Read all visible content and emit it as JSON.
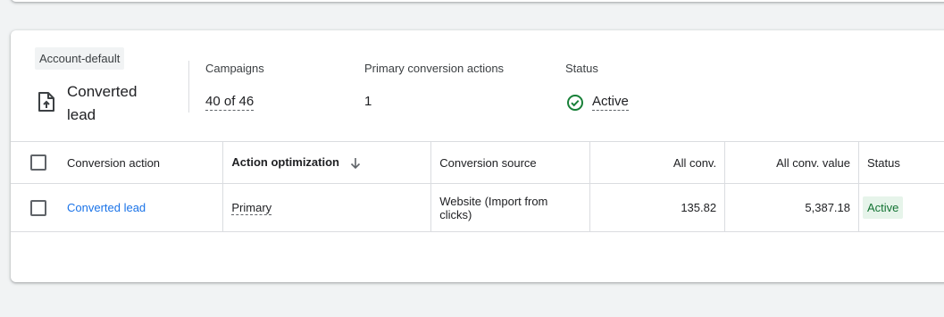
{
  "summary": {
    "chip": "Account-default",
    "goal_name": "Converted lead",
    "goal_icon": "upload-file-icon",
    "campaigns_label": "Campaigns",
    "campaigns_value": "40 of 46",
    "primary_label": "Primary conversion actions",
    "primary_value": "1",
    "status_label": "Status",
    "status_value": "Active",
    "status_icon": "check-circle-icon",
    "status_color": "#188038"
  },
  "table": {
    "headers": {
      "action": "Conversion action",
      "optimization": "Action optimization",
      "source": "Conversion source",
      "all_conv": "All conv.",
      "all_conv_value": "All conv. value",
      "status": "Status"
    },
    "rows": [
      {
        "action": "Converted lead",
        "optimization": "Primary",
        "source": "Website (Import from clicks)",
        "all_conv": "135.82",
        "all_conv_value": "5,387.18",
        "status": "Active"
      }
    ]
  }
}
